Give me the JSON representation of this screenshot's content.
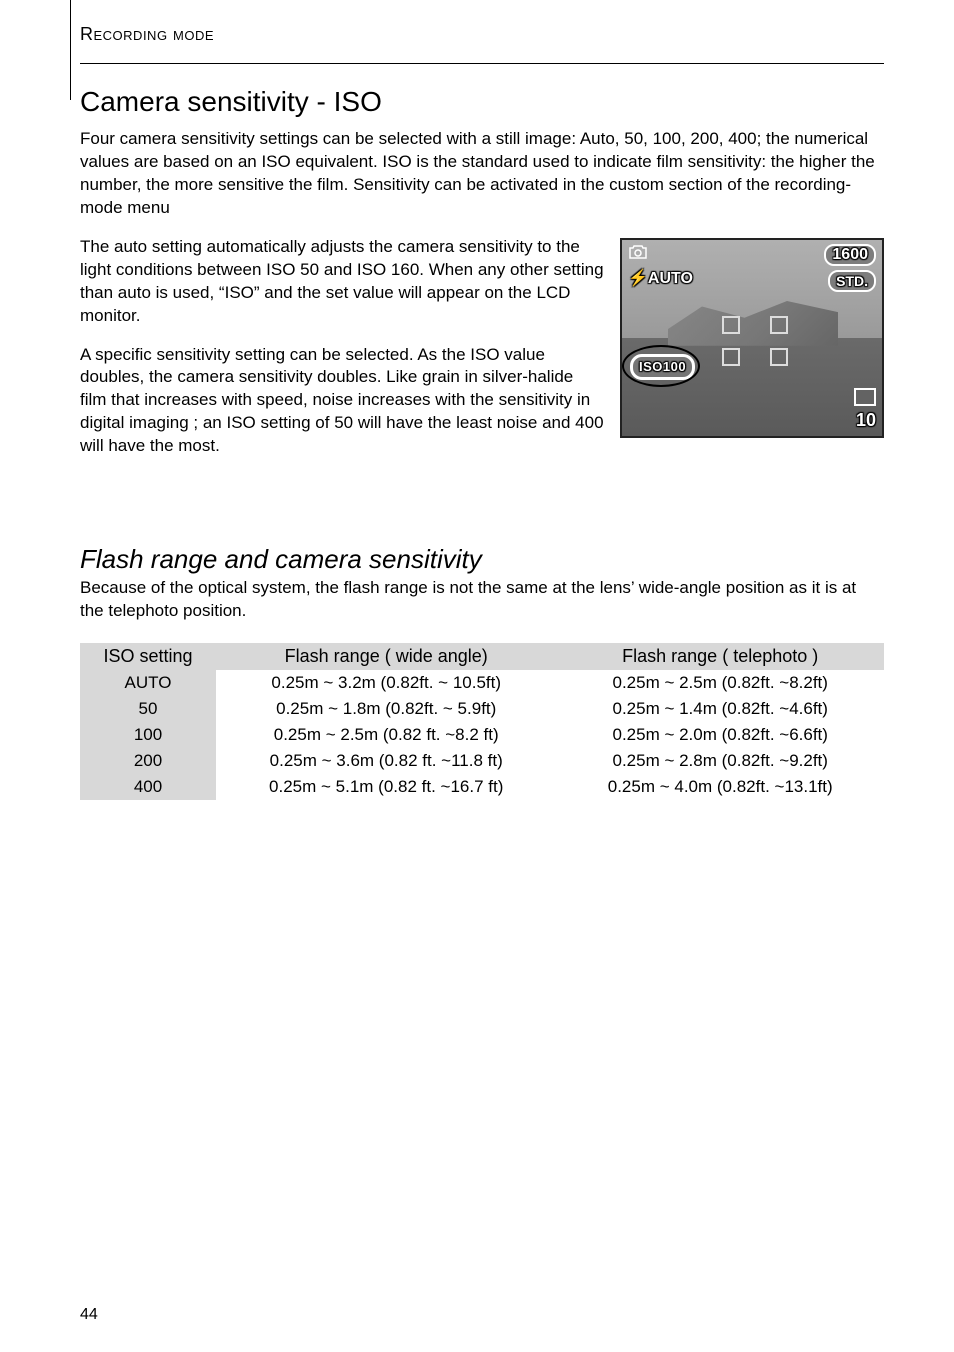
{
  "header": "Recording mode",
  "h1": "Camera sensitivity - ISO",
  "p1": "Four camera sensitivity settings can be selected with a still image: Auto, 50, 100, 200, 400; the numerical values are based on an ISO equivalent. ISO is the standard used to indicate film sensitivity: the higher the number, the more sensitive the film. Sensitivity can be activated in the custom section of the recording-mode menu",
  "p2": "The auto setting automatically adjusts the camera sensitivity to the light conditions between ISO 50 and ISO 160. When any other setting than auto is used, “ISO” and the set value will appear on the LCD monitor.",
  "p3": "A specific sensitivity setting can be selected. As the ISO value doubles, the camera sensitivity doubles. Like grain in silver-halide film that increases with speed, noise increases with the sensitivity in digital imaging ; an ISO setting of 50 will have the least noise and 400 will have the most.",
  "h2": "Flash range and camera sensitivity",
  "p4": "Because of the optical system, the flash range is not the same at the lens’ wide-angle position as it is at the telephoto position.",
  "lcd": {
    "camera_icon": "camera",
    "flash_auto_label": "⚡AUTO",
    "iso_label": "ISO100",
    "resolution": "1600",
    "quality": "STD.",
    "frames": "10"
  },
  "table": {
    "headers": {
      "setting": "ISO setting",
      "wide": "Flash range ( wide angle)",
      "tele": "Flash range ( telephoto )"
    },
    "rows": [
      {
        "setting": "AUTO",
        "wide": "0.25m ~ 3.2m (0.82ft. ~ 10.5ft)",
        "tele": "0.25m ~ 2.5m (0.82ft. ~8.2ft)"
      },
      {
        "setting": "50",
        "wide": "0.25m ~ 1.8m (0.82ft. ~ 5.9ft)",
        "tele": "0.25m ~ 1.4m (0.82ft. ~4.6ft)"
      },
      {
        "setting": "100",
        "wide": "0.25m ~ 2.5m (0.82 ft. ~8.2 ft)",
        "tele": "0.25m ~ 2.0m (0.82ft. ~6.6ft)"
      },
      {
        "setting": "200",
        "wide": "0.25m ~ 3.6m (0.82 ft. ~11.8 ft)",
        "tele": "0.25m ~ 2.8m (0.82ft. ~9.2ft)"
      },
      {
        "setting": "400",
        "wide": "0.25m ~ 5.1m (0.82 ft. ~16.7 ft)",
        "tele": "0.25m ~ 4.0m (0.82ft. ~13.1ft)"
      }
    ]
  },
  "page_number": "44"
}
